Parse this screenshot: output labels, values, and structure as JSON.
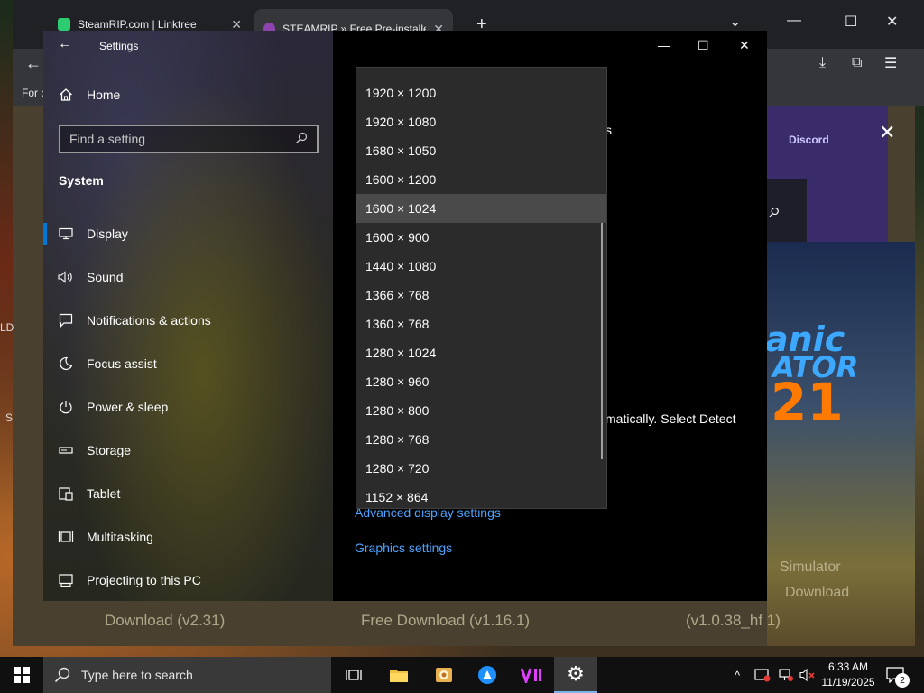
{
  "browser": {
    "tabs": [
      {
        "title": "SteamRIP.com | Linktree",
        "close": "✕"
      },
      {
        "title": "STEAMRIP » Free Pre-installed",
        "close": "✕"
      }
    ],
    "bookmark_fragment": "For c"
  },
  "page": {
    "promo_word_1": "anic",
    "promo_word_2": "ATOR",
    "promo_number": "21",
    "promo_discord": "Discord",
    "caption_left": "Download (v2.31)",
    "caption_middle": "Free Download (v1.16.1)",
    "caption_right": "(v1.0.38_hf 1)",
    "caption_side_1": "Simulator",
    "caption_side_2": "Download",
    "left_edge_text_1": "LD",
    "left_edge_text_2": "S"
  },
  "settings": {
    "window_title": "Settings",
    "home_label": "Home",
    "search_placeholder": "Find a setting",
    "section_heading": "System",
    "nav_items": [
      {
        "label": "Display",
        "icon": "monitor-icon"
      },
      {
        "label": "Sound",
        "icon": "speaker-icon"
      },
      {
        "label": "Notifications & actions",
        "icon": "notification-icon"
      },
      {
        "label": "Focus assist",
        "icon": "moon-icon"
      },
      {
        "label": "Power & sleep",
        "icon": "power-icon"
      },
      {
        "label": "Storage",
        "icon": "storage-icon"
      },
      {
        "label": "Tablet",
        "icon": "tablet-icon"
      },
      {
        "label": "Multitasking",
        "icon": "multitasking-icon"
      },
      {
        "label": "Projecting to this PC",
        "icon": "projector-icon"
      }
    ],
    "main_fragment_1": "s",
    "main_fragment_2": "matically. Select Detect",
    "advanced_link": "Advanced display settings",
    "graphics_link": "Graphics settings"
  },
  "resolution_dropdown": {
    "selected": "1600 × 1024",
    "options": [
      "1920 × 1200",
      "1920 × 1080",
      "1680 × 1050",
      "1600 × 1200",
      "1600 × 1024",
      "1600 × 900",
      "1440 × 1080",
      "1366 × 768",
      "1360 × 768",
      "1280 × 1024",
      "1280 × 960",
      "1280 × 800",
      "1280 × 768",
      "1280 × 720",
      "1152 × 864"
    ]
  },
  "taskbar": {
    "search_placeholder": "Type here to search",
    "time": "6:33 AM",
    "date": "11/19/2025",
    "notification_count": "2"
  },
  "colors": {
    "accent": "#0078d7",
    "link": "#4ca3ff",
    "dropdown_bg": "#2b2b2b",
    "dropdown_highlight": "#4a4a4a"
  }
}
